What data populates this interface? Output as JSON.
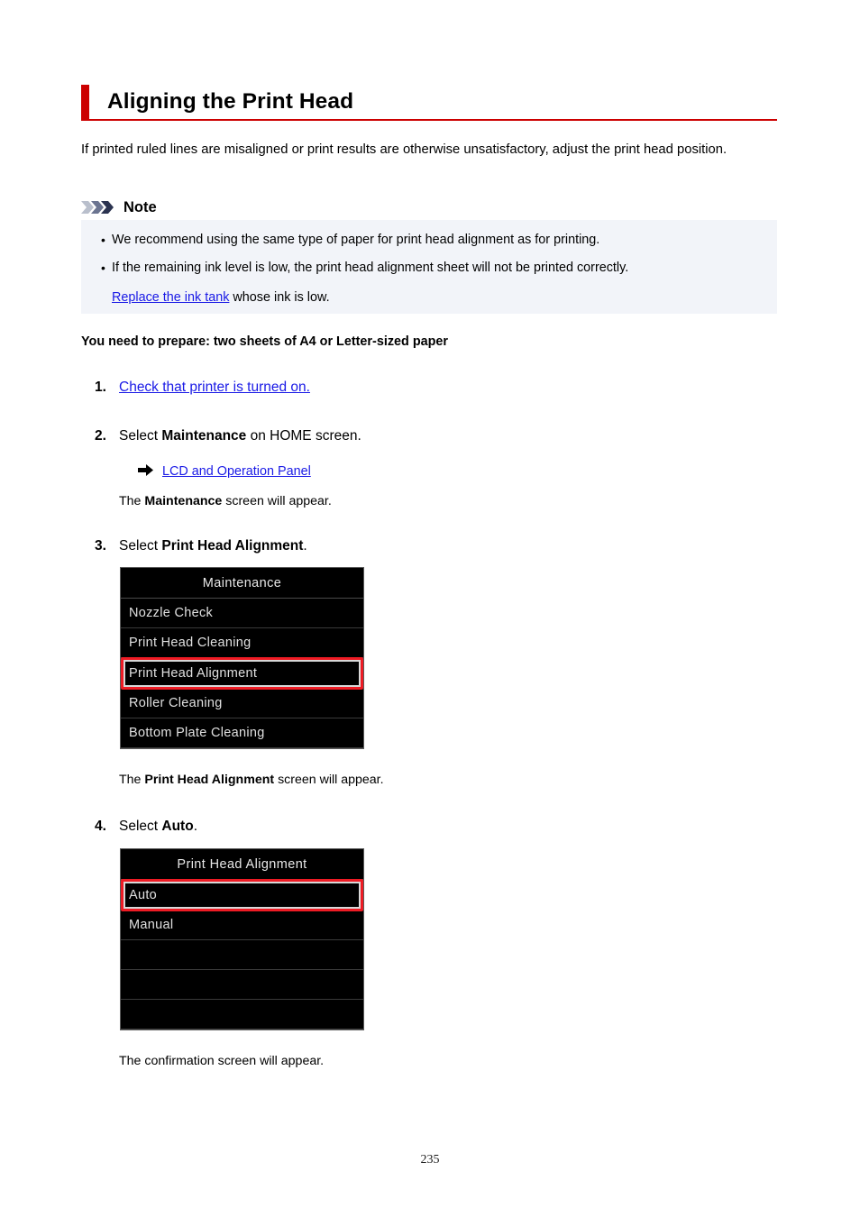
{
  "document": {
    "title": "Aligning the Print Head",
    "accent_color": "#cc0000",
    "intro": "If printed ruled lines are misaligned or print results are otherwise unsatisfactory, adjust the print head position.",
    "page_number": "235"
  },
  "note": {
    "label": "Note",
    "background_color": "#f2f4f9",
    "items": [
      "We recommend using the same type of paper for print head alignment as for printing.",
      "If the remaining ink level is low, the print head alignment sheet will not be printed correctly."
    ],
    "sub_link": "Replace the ink tank",
    "sub_after": " whose ink is low."
  },
  "prepare": "You need to prepare: two sheets of A4 or Letter-sized paper",
  "steps": [
    {
      "num": "1.",
      "link": "Check that printer is turned on."
    },
    {
      "num": "2.",
      "text_before": "Select ",
      "bold": "Maintenance",
      "text_after": " on HOME screen.",
      "reference_link": "LCD and Operation Panel",
      "result_before": "The ",
      "result_bold": "Maintenance",
      "result_after": " screen will appear."
    },
    {
      "num": "3.",
      "text_before": "Select ",
      "bold": "Print Head Alignment",
      "text_after": ".",
      "result_before": "The ",
      "result_bold": "Print Head Alignment",
      "result_after": " screen will appear."
    },
    {
      "num": "4.",
      "text_before": "Select ",
      "bold": "Auto",
      "text_after": ".",
      "result": "The confirmation screen will appear."
    }
  ],
  "lcd_maintenance": {
    "header": "Maintenance",
    "rows": [
      {
        "label": "Nozzle Check",
        "selected": false
      },
      {
        "label": "Print Head Cleaning",
        "selected": false
      },
      {
        "label": "Print Head Alignment",
        "selected": true
      },
      {
        "label": "Roller Cleaning",
        "selected": false
      },
      {
        "label": "Bottom Plate Cleaning",
        "selected": false
      }
    ],
    "highlight_color": "#ee1b24"
  },
  "lcd_alignment": {
    "header": "Print Head Alignment",
    "rows": [
      {
        "label": "Auto",
        "selected": true
      },
      {
        "label": "Manual",
        "selected": false
      },
      {
        "label": "",
        "selected": false
      },
      {
        "label": "",
        "selected": false
      },
      {
        "label": "",
        "selected": false
      },
      {
        "label": "",
        "selected": false
      }
    ],
    "highlight_color": "#ee1b24"
  },
  "icons": {
    "note_chevrons": "chevron-triple-icon",
    "reference_arrow": "arrow-right-icon"
  }
}
